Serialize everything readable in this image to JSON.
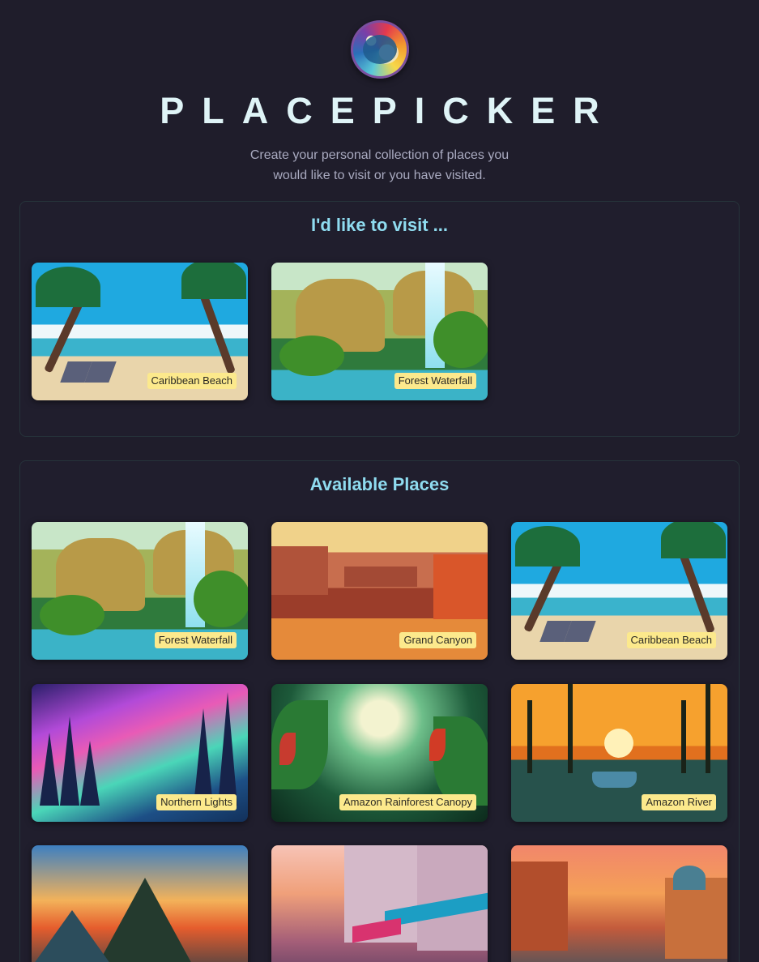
{
  "header": {
    "logo_icon": "globe-logo",
    "title": "PLACEPICKER",
    "subtitle": "Create your personal collection of places you would like to visit or you have visited."
  },
  "selected": {
    "heading": "I'd like to visit ...",
    "places": [
      {
        "label": "Caribbean Beach",
        "scene": "beach"
      },
      {
        "label": "Forest Waterfall",
        "scene": "waterfall"
      }
    ]
  },
  "available": {
    "heading": "Available Places",
    "places": [
      {
        "label": "Forest Waterfall",
        "scene": "waterfall"
      },
      {
        "label": "Grand Canyon",
        "scene": "canyon"
      },
      {
        "label": "Caribbean Beach",
        "scene": "beach"
      },
      {
        "label": "Northern Lights",
        "scene": "aurora"
      },
      {
        "label": "Amazon Rainforest Canopy",
        "scene": "rainforest"
      },
      {
        "label": "Amazon River",
        "scene": "river"
      },
      {
        "label": "",
        "scene": "machu"
      },
      {
        "label": "",
        "scene": "cafe"
      },
      {
        "label": "",
        "scene": "venice"
      }
    ]
  },
  "colors": {
    "background": "#1f1d2b",
    "heading": "#8fdcf0",
    "label_bg": "#fce98c"
  }
}
